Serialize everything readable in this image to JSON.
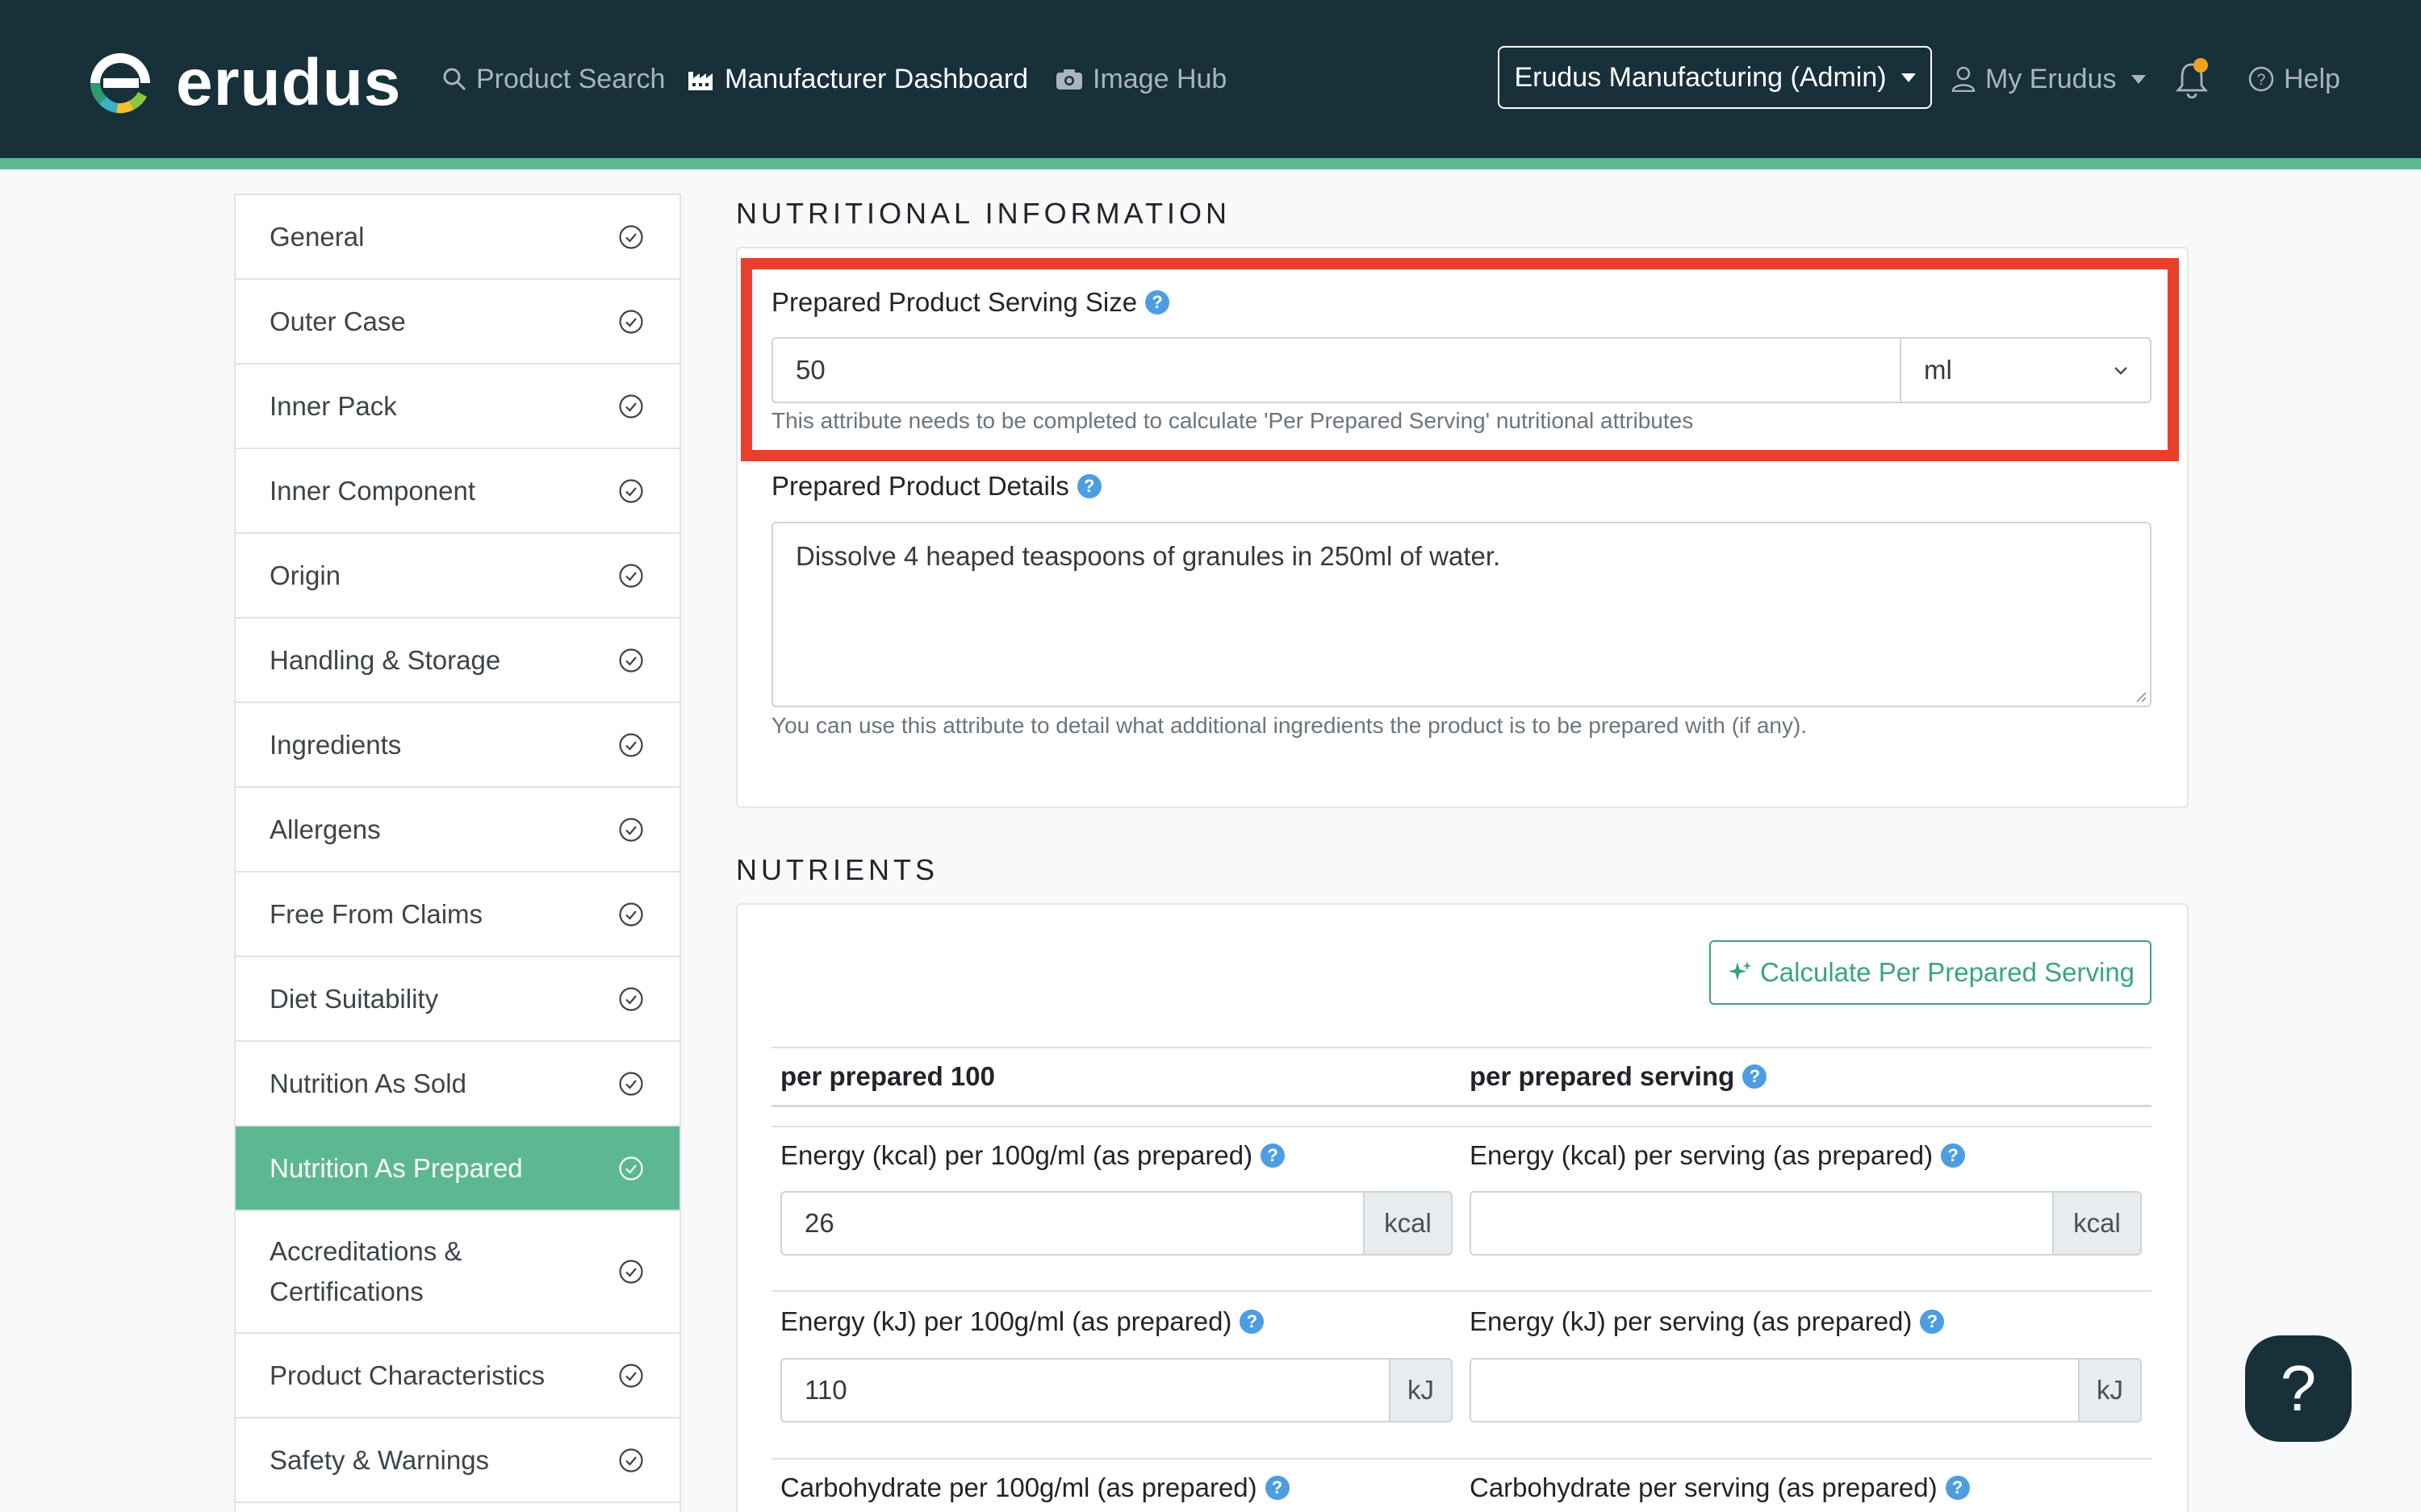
{
  "header": {
    "logo_text": "erudus",
    "nav": {
      "product_search": "Product Search",
      "manufacturer_dashboard": "Manufacturer Dashboard",
      "image_hub": "Image Hub"
    },
    "account": "Erudus Manufacturing (Admin)",
    "my_erudus": "My Erudus",
    "help": "Help"
  },
  "sidebar": {
    "items": [
      {
        "label": "General"
      },
      {
        "label": "Outer Case"
      },
      {
        "label": "Inner Pack"
      },
      {
        "label": "Inner Component"
      },
      {
        "label": "Origin"
      },
      {
        "label": "Handling & Storage"
      },
      {
        "label": "Ingredients"
      },
      {
        "label": "Allergens"
      },
      {
        "label": "Free From Claims"
      },
      {
        "label": "Diet Suitability"
      },
      {
        "label": "Nutrition As Sold"
      },
      {
        "label": "Nutrition As Prepared",
        "active": true
      },
      {
        "label": "Accreditations & Certifications"
      },
      {
        "label": "Product Characteristics"
      },
      {
        "label": "Safety & Warnings"
      }
    ]
  },
  "nutritional_info": {
    "section_title": "NUTRITIONAL INFORMATION",
    "serving_size": {
      "label": "Prepared Product Serving Size",
      "value": "50",
      "unit": "ml",
      "hint": "This attribute needs to be completed to calculate 'Per Prepared Serving' nutritional attributes"
    },
    "details": {
      "label": "Prepared Product Details",
      "value": "Dissolve 4 heaped teaspoons of granules in 250ml of water.",
      "hint": "You can use this attribute to detail what additional ingredients the product is to be prepared with (if any)."
    }
  },
  "nutrients": {
    "section_title": "NUTRIENTS",
    "calc_button": "Calculate Per Prepared Serving",
    "col_per100": "per prepared 100",
    "col_serving": "per prepared serving",
    "rows": [
      {
        "label_100": "Energy (kcal) per 100g/ml (as prepared)",
        "value_100": "26",
        "label_serving": "Energy (kcal) per serving (as prepared)",
        "value_serving": "",
        "unit": "kcal"
      },
      {
        "label_100": "Energy (kJ) per 100g/ml (as prepared)",
        "value_100": "110",
        "label_serving": "Energy (kJ) per serving (as prepared)",
        "value_serving": "",
        "unit": "kJ"
      },
      {
        "label_100": "Carbohydrate per 100g/ml (as prepared)",
        "label_serving": "Carbohydrate per serving (as prepared)"
      }
    ]
  },
  "fab": {
    "label": "?"
  },
  "colors": {
    "header": "#17303a",
    "accent": "#5cb893",
    "highlight": "#e93f2c",
    "help": "#4d9de3"
  }
}
